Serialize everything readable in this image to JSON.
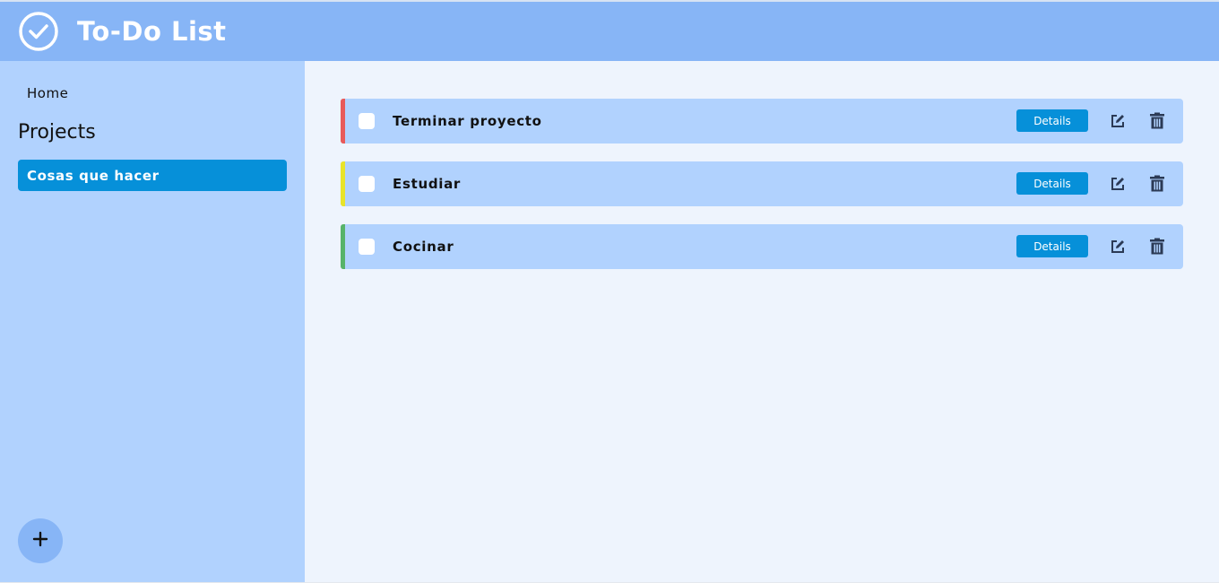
{
  "header": {
    "title": "To-Do List",
    "logo_icon": "check-circle-icon",
    "background": "#87b5f6"
  },
  "sidebar": {
    "home_label": "Home",
    "projects_heading": "Projects",
    "projects": [
      {
        "label": "Cosas que hacer",
        "active": true
      }
    ],
    "add_icon": "plus-icon",
    "background": "#b1d2fe",
    "accent": "#0690d9"
  },
  "tasks": [
    {
      "title": "Terminar proyecto",
      "priority_color": "#e85a5a",
      "details_label": "Details",
      "edit_icon": "edit-icon",
      "delete_icon": "trash-icon"
    },
    {
      "title": "Estudiar",
      "priority_color": "#e8e42a",
      "details_label": "Details",
      "edit_icon": "edit-icon",
      "delete_icon": "trash-icon"
    },
    {
      "title": "Cocinar",
      "priority_color": "#57b36a",
      "details_label": "Details",
      "edit_icon": "edit-icon",
      "delete_icon": "trash-icon"
    }
  ]
}
